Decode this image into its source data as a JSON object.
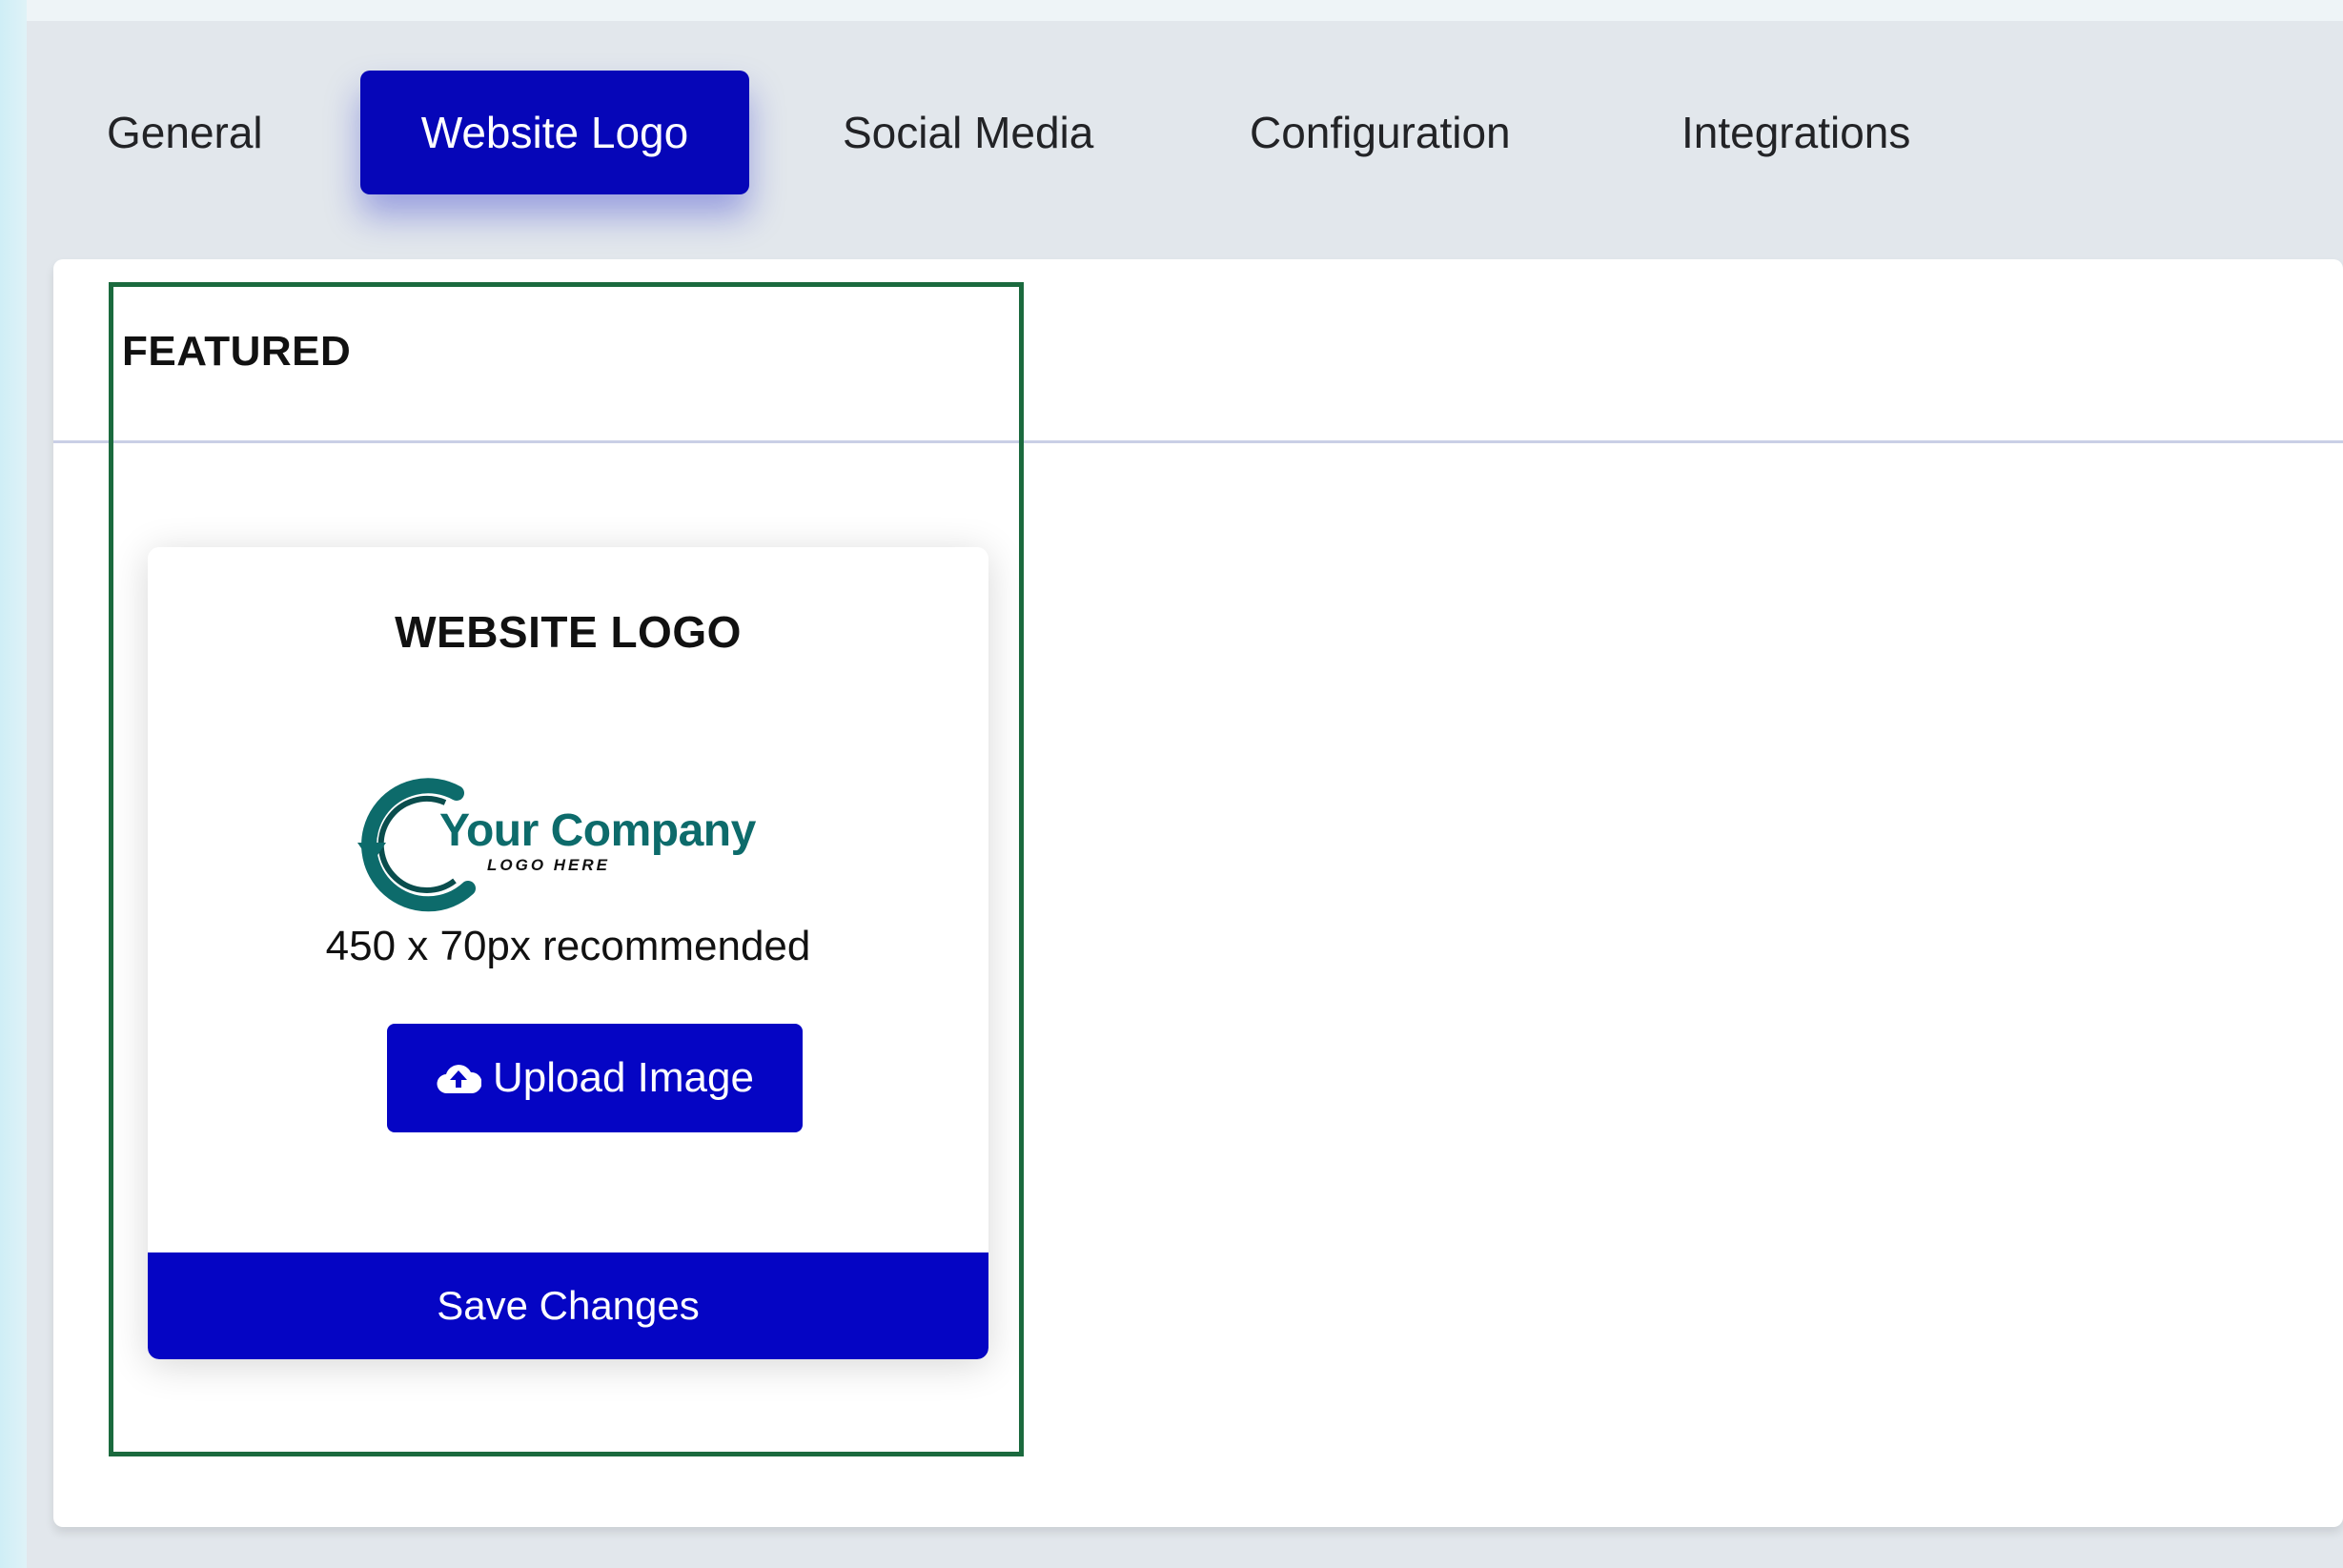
{
  "tabs": [
    {
      "label": "General",
      "active": false
    },
    {
      "label": "Website Logo",
      "active": true
    },
    {
      "label": "Social Media",
      "active": false
    },
    {
      "label": "Configuration",
      "active": false
    },
    {
      "label": "Integrations",
      "active": false
    }
  ],
  "panel": {
    "title": "FEATURED"
  },
  "card": {
    "title": "WEBSITE LOGO",
    "logo": {
      "company": "Your Company",
      "tagline": "LOGO HERE"
    },
    "hint": "450 x 70px recommended",
    "upload_label": "Upload Image",
    "upload_icon": "cloud-upload-icon",
    "save_label": "Save Changes"
  },
  "colors": {
    "accent": "#0606b8",
    "highlight_border": "#1b6a3e",
    "logo_teal": "#0d6b6b"
  }
}
